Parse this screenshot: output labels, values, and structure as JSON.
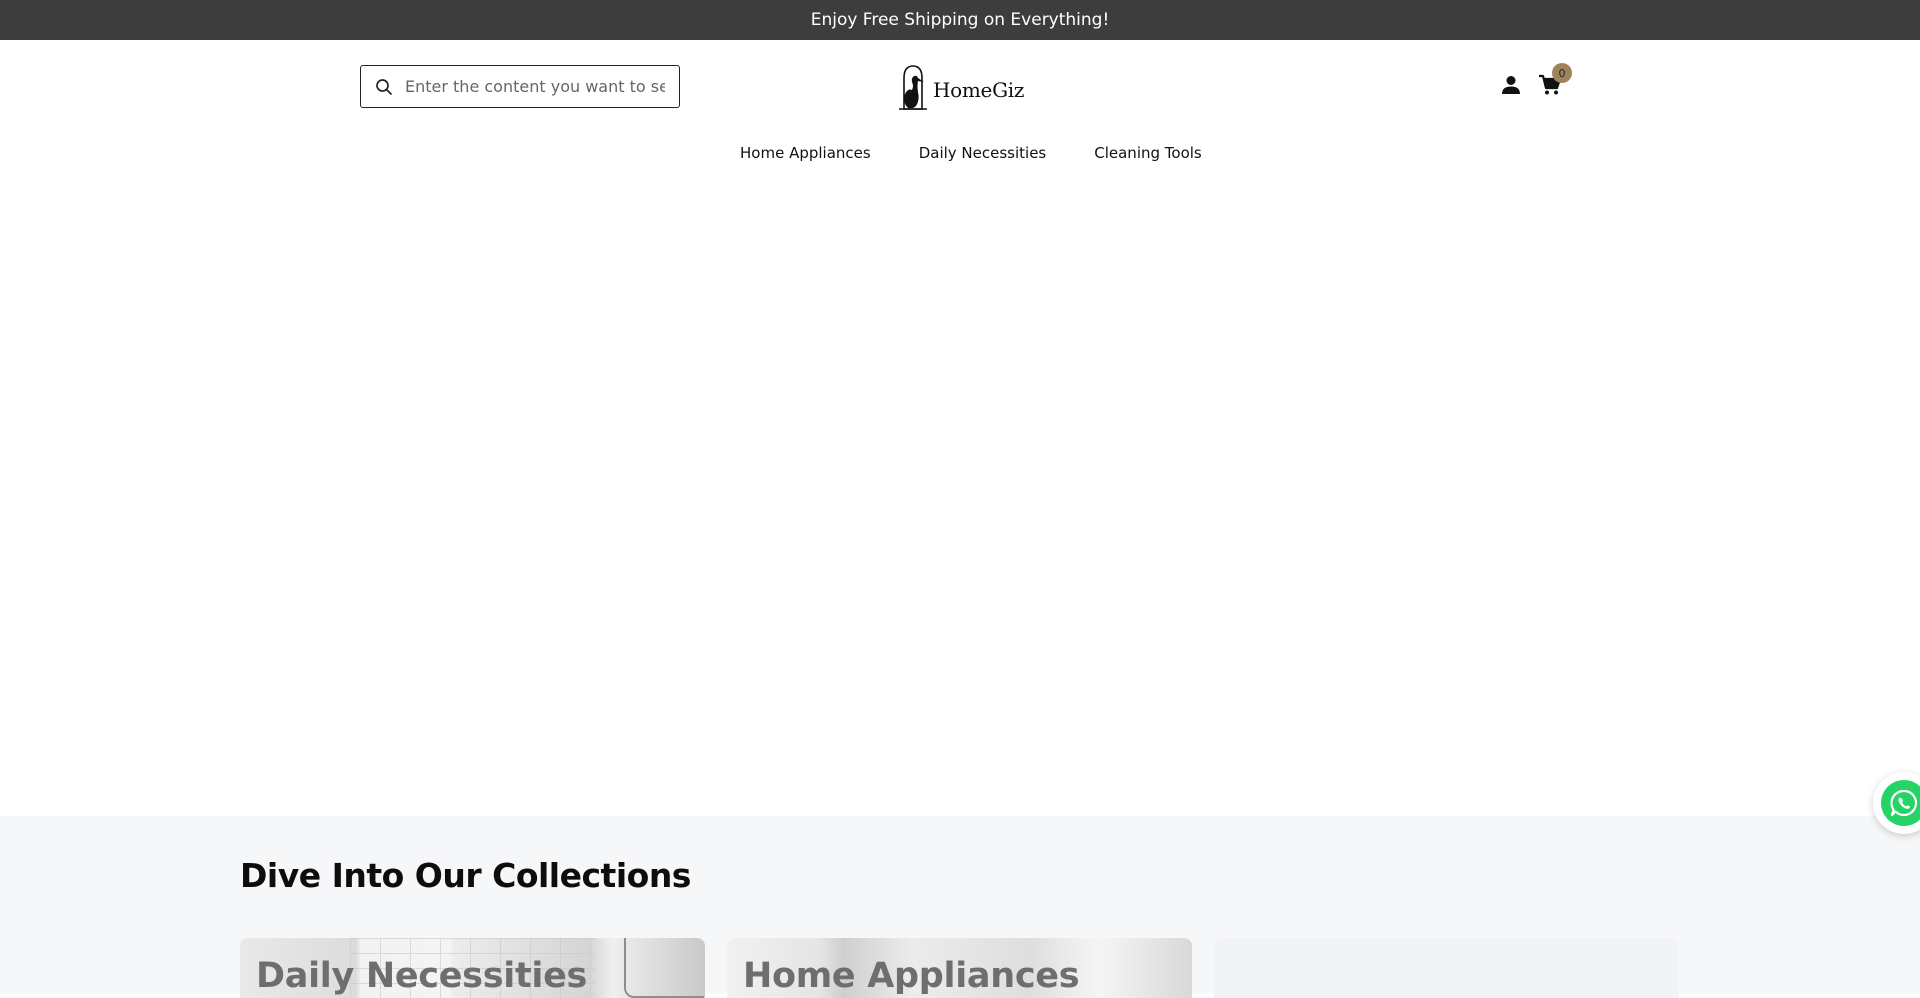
{
  "announcement": {
    "text": "Enjoy Free Shipping on Everything!"
  },
  "header": {
    "search": {
      "placeholder": "Enter the content you want to search",
      "icon": "search-icon"
    },
    "logo": {
      "text": "HomeGiz",
      "icon": "pelican-logo-icon"
    },
    "account": {
      "icon": "account-icon"
    },
    "cart": {
      "icon": "cart-icon",
      "count": "0"
    }
  },
  "nav": {
    "items": [
      {
        "label": "Home Appliances"
      },
      {
        "label": "Daily Necessities"
      },
      {
        "label": "Cleaning Tools"
      }
    ]
  },
  "collections": {
    "title": "Dive Into Our Collections",
    "cards": [
      {
        "label": "Daily Necessities"
      },
      {
        "label": "Home Appliances"
      },
      {
        "label": ""
      }
    ]
  },
  "floating": {
    "whatsapp_icon": "whatsapp-icon"
  },
  "colors": {
    "announcement_bg": "#3d3d3d",
    "cart_badge": "#a0825d",
    "whatsapp": "#25d366",
    "collections_bg": "#f6f7f9"
  }
}
